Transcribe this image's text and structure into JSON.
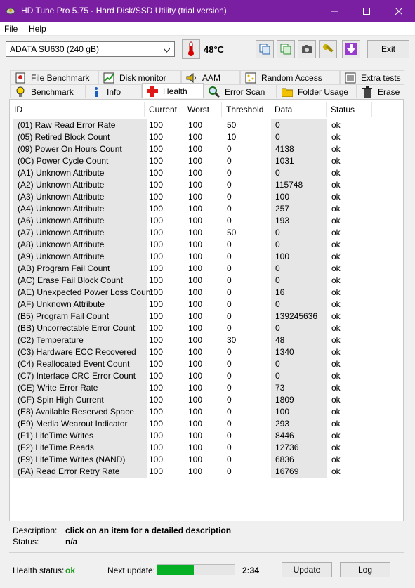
{
  "window": {
    "title": "HD Tune Pro 5.75 - Hard Disk/SSD Utility (trial version)"
  },
  "menu": {
    "file": "File",
    "help": "Help"
  },
  "toolbar": {
    "drive": "ADATA SU630 (240 gB)",
    "temperature": "48°C",
    "exit_label": "Exit"
  },
  "tabs_top": [
    "File Benchmark",
    "Disk monitor",
    "AAM",
    "Random Access",
    "Extra tests"
  ],
  "tabs_bottom": [
    "Benchmark",
    "Info",
    "Health",
    "Error Scan",
    "Folder Usage",
    "Erase"
  ],
  "active_tab": "Health",
  "columns": [
    "ID",
    "Current",
    "Worst",
    "Threshold",
    "Data",
    "Status"
  ],
  "rows": [
    {
      "id": "(01) Raw Read Error Rate",
      "current": "100",
      "worst": "100",
      "threshold": "50",
      "data": "0",
      "status": "ok"
    },
    {
      "id": "(05) Retired Block Count",
      "current": "100",
      "worst": "100",
      "threshold": "10",
      "data": "0",
      "status": "ok"
    },
    {
      "id": "(09) Power On Hours Count",
      "current": "100",
      "worst": "100",
      "threshold": "0",
      "data": "4138",
      "status": "ok"
    },
    {
      "id": "(0C) Power Cycle Count",
      "current": "100",
      "worst": "100",
      "threshold": "0",
      "data": "1031",
      "status": "ok"
    },
    {
      "id": "(A1) Unknown Attribute",
      "current": "100",
      "worst": "100",
      "threshold": "0",
      "data": "0",
      "status": "ok"
    },
    {
      "id": "(A2) Unknown Attribute",
      "current": "100",
      "worst": "100",
      "threshold": "0",
      "data": "115748",
      "status": "ok"
    },
    {
      "id": "(A3) Unknown Attribute",
      "current": "100",
      "worst": "100",
      "threshold": "0",
      "data": "100",
      "status": "ok"
    },
    {
      "id": "(A4) Unknown Attribute",
      "current": "100",
      "worst": "100",
      "threshold": "0",
      "data": "257",
      "status": "ok"
    },
    {
      "id": "(A6) Unknown Attribute",
      "current": "100",
      "worst": "100",
      "threshold": "0",
      "data": "193",
      "status": "ok"
    },
    {
      "id": "(A7) Unknown Attribute",
      "current": "100",
      "worst": "100",
      "threshold": "50",
      "data": "0",
      "status": "ok"
    },
    {
      "id": "(A8) Unknown Attribute",
      "current": "100",
      "worst": "100",
      "threshold": "0",
      "data": "0",
      "status": "ok"
    },
    {
      "id": "(A9) Unknown Attribute",
      "current": "100",
      "worst": "100",
      "threshold": "0",
      "data": "100",
      "status": "ok"
    },
    {
      "id": "(AB) Program Fail Count",
      "current": "100",
      "worst": "100",
      "threshold": "0",
      "data": "0",
      "status": "ok"
    },
    {
      "id": "(AC) Erase Fail Block Count",
      "current": "100",
      "worst": "100",
      "threshold": "0",
      "data": "0",
      "status": "ok"
    },
    {
      "id": "(AE) Unexpected Power Loss Count",
      "current": "100",
      "worst": "100",
      "threshold": "0",
      "data": "16",
      "status": "ok"
    },
    {
      "id": "(AF) Unknown Attribute",
      "current": "100",
      "worst": "100",
      "threshold": "0",
      "data": "0",
      "status": "ok"
    },
    {
      "id": "(B5) Program Fail Count",
      "current": "100",
      "worst": "100",
      "threshold": "0",
      "data": "139245636",
      "status": "ok"
    },
    {
      "id": "(BB) Uncorrectable Error Count",
      "current": "100",
      "worst": "100",
      "threshold": "0",
      "data": "0",
      "status": "ok"
    },
    {
      "id": "(C2) Temperature",
      "current": "100",
      "worst": "100",
      "threshold": "30",
      "data": "48",
      "status": "ok"
    },
    {
      "id": "(C3) Hardware ECC Recovered",
      "current": "100",
      "worst": "100",
      "threshold": "0",
      "data": "1340",
      "status": "ok"
    },
    {
      "id": "(C4) Reallocated Event Count",
      "current": "100",
      "worst": "100",
      "threshold": "0",
      "data": "0",
      "status": "ok"
    },
    {
      "id": "(C7) Interface CRC Error Count",
      "current": "100",
      "worst": "100",
      "threshold": "0",
      "data": "0",
      "status": "ok"
    },
    {
      "id": "(CE) Write Error Rate",
      "current": "100",
      "worst": "100",
      "threshold": "0",
      "data": "73",
      "status": "ok"
    },
    {
      "id": "(CF) Spin High Current",
      "current": "100",
      "worst": "100",
      "threshold": "0",
      "data": "1809",
      "status": "ok"
    },
    {
      "id": "(E8) Available Reserved Space",
      "current": "100",
      "worst": "100",
      "threshold": "0",
      "data": "100",
      "status": "ok"
    },
    {
      "id": "(E9) Media Wearout Indicator",
      "current": "100",
      "worst": "100",
      "threshold": "0",
      "data": "293",
      "status": "ok"
    },
    {
      "id": "(F1) LifeTime Writes",
      "current": "100",
      "worst": "100",
      "threshold": "0",
      "data": "8446",
      "status": "ok"
    },
    {
      "id": "(F2) LifeTime Reads",
      "current": "100",
      "worst": "100",
      "threshold": "0",
      "data": "12736",
      "status": "ok"
    },
    {
      "id": "(F9) LifeTime Writes (NAND)",
      "current": "100",
      "worst": "100",
      "threshold": "0",
      "data": "6836",
      "status": "ok"
    },
    {
      "id": "(FA) Read Error Retry Rate",
      "current": "100",
      "worst": "100",
      "threshold": "0",
      "data": "16769",
      "status": "ok"
    }
  ],
  "footer": {
    "description_label": "Description:",
    "description_value": "click on an item for a detailed description",
    "status_label": "Status:",
    "status_value": "n/a",
    "health_label": "Health status:",
    "health_value": "ok",
    "next_update_label": "Next update:",
    "next_update_time": "2:34",
    "next_update_progress": 0.47,
    "update_label": "Update",
    "log_label": "Log"
  }
}
